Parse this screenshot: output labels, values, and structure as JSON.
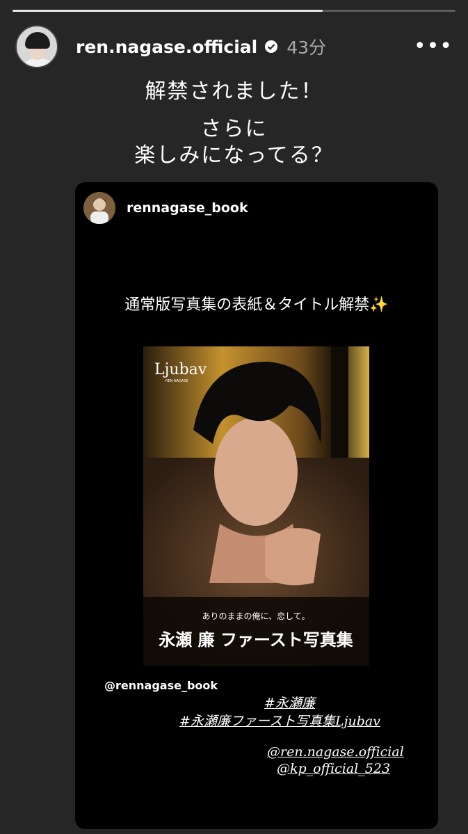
{
  "story": {
    "progress": 0.7
  },
  "header": {
    "username": "ren.nagase.official",
    "time": "43分",
    "more": "•••"
  },
  "caption": {
    "line1": "解禁されました！",
    "line2": "さらに",
    "line3": "楽しみになってる？"
  },
  "repost": {
    "username": "rennagase_book",
    "announcement": "通常版写真集の表紙＆タイトル解禁✨",
    "cover_brand": "Ljubav",
    "cover_sub": "REN NAGASE",
    "cover_tagline": "ありのままの俺に、恋して。",
    "cover_title": "永瀬 廉 ファースト写真集",
    "mention": "@rennagase_book",
    "hashtag1": "#永瀬廉",
    "hashtag2": "#永瀬廉ファースト写真集Ljubav",
    "mention2": "@ren.nagase.official",
    "mention3": "@kp_official_523"
  },
  "colors": {
    "background": "#262626",
    "card": "#000000",
    "verified": "#3897f0"
  }
}
